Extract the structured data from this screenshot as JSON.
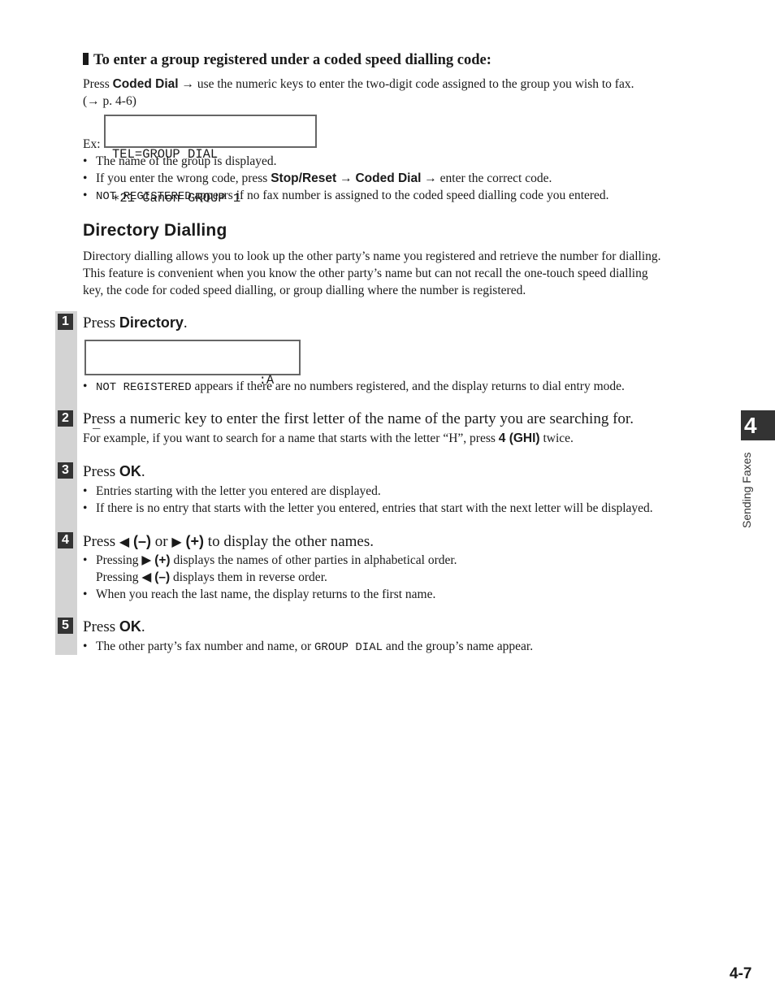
{
  "group_section": {
    "heading": "To enter a group registered under a coded speed dialling code:",
    "intro_prefix": "Press ",
    "intro_key": "Coded Dial",
    "intro_rest": " → use the numeric keys to enter the two-digit code assigned to the group you wish to fax.",
    "intro_ref": "(→ p. 4-6)",
    "example_label": "Ex:",
    "lcd_line1": "TEL=GROUP DIAL",
    "lcd_line2": "∗21 Canon GROUP 1",
    "bullets": [
      {
        "text": "The name of the group is displayed."
      },
      {
        "pre": "If you enter the wrong code, press ",
        "key1": "Stop/Reset",
        "mid": " → ",
        "key2": "Coded Dial",
        "post": " → enter the correct code."
      },
      {
        "mono": "NOT REGISTERED",
        "post": " appears if no fax number is assigned to the coded speed dialling code you entered."
      }
    ]
  },
  "directory_section": {
    "title": "Directory Dialling",
    "paragraph": [
      "Directory dialling allows you to look up the other party’s name you registered and retrieve the number for dialling.",
      "This feature is convenient when you know the other party’s name but can not recall the one-touch speed dialling",
      "key, the code for coded speed dialling, or group dialling where the number is registered."
    ]
  },
  "steps": [
    {
      "number": "1",
      "pre": "Press ",
      "key": "Directory",
      "post": ".",
      "lcd_line1": "                      :A",
      "lcd_line2": "_",
      "bullet_mono": "NOT REGISTERED",
      "bullet_post": " appears if there are no numbers registered, and the display returns to dial entry mode."
    },
    {
      "number": "2",
      "title": "Press a numeric key to enter the first letter of the name of the party you are searching for.",
      "note_pre": "For example, if you want to search for a name that starts with the letter “H”, press ",
      "note_key": "4 (GHI)",
      "note_post": " twice."
    },
    {
      "number": "3",
      "pre": "Press ",
      "key": "OK",
      "post": ".",
      "bullets": [
        "Entries starting with the letter you entered are displayed.",
        "If there is no entry that starts with the letter you entered, entries that start with the next letter will be displayed."
      ]
    },
    {
      "number": "4",
      "pre": "Press ",
      "left_arrow": "◀",
      "left_key": "(–)",
      "or": " or ",
      "right_arrow": "▶",
      "right_key": "(+)",
      "post": " to display the other names.",
      "b1_pre": "Pressing ",
      "b1_arrow": "▶",
      "b1_key": "(+)",
      "b1_post": " displays the names of other parties in alphabetical order.",
      "b1_line2_pre": "Pressing ",
      "b1_line2_arrow": "◀",
      "b1_line2_key": "(–)",
      "b1_line2_post": " displays them in reverse order.",
      "b2": "When you reach the last name, the display returns to the first name."
    },
    {
      "number": "5",
      "pre": "Press ",
      "key": "OK",
      "post": ".",
      "bullet_pre": "The other party’s fax number and name, or ",
      "bullet_mono": "GROUP DIAL",
      "bullet_post": " and the group’s name appear."
    }
  ],
  "chapter_tab": {
    "number": "4",
    "label": "Sending Faxes"
  },
  "page_number": "4-7",
  "bullet_char": "•"
}
